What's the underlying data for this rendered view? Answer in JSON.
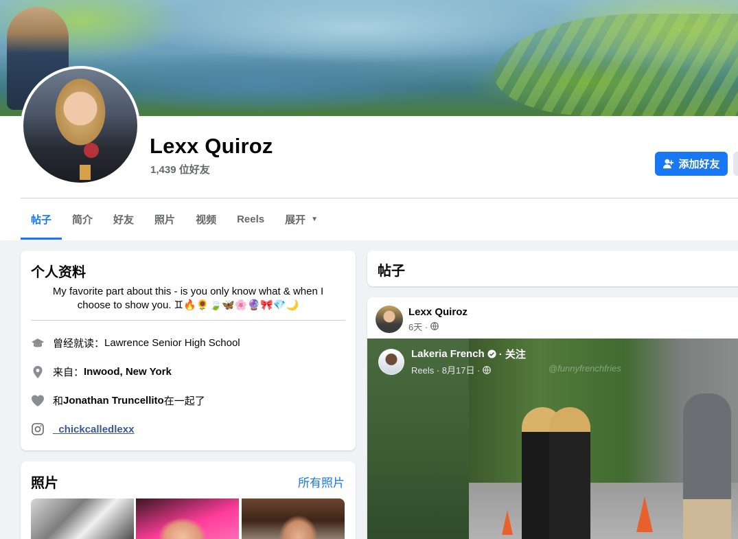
{
  "profile": {
    "name": "Lexx Quiroz",
    "friends_count": "1,439 位好友",
    "add_friend_label": "添加好友"
  },
  "tabs": [
    {
      "label": "帖子",
      "active": true
    },
    {
      "label": "简介"
    },
    {
      "label": "好友"
    },
    {
      "label": "照片"
    },
    {
      "label": "视频"
    },
    {
      "label": "Reels"
    },
    {
      "label": "展开"
    }
  ],
  "intro": {
    "title": "个人资料",
    "bio": "My favorite part about this - is you only know what & when I choose to show you. ♊🔥🌻🍃🦋🌸🔮🎀💎🌙",
    "education_prefix": "曾经就读：",
    "education_value": "Lawrence Senior High School",
    "from_prefix": "来自：",
    "from_value": "Inwood, New York",
    "relationship_prefix": "和 ",
    "relationship_name": "Jonathan Truncellito",
    "relationship_suffix": " 在一起了",
    "instagram": "_chickcalledlexx"
  },
  "photos": {
    "title": "照片",
    "all_link": "所有照片"
  },
  "posts": {
    "title": "帖子",
    "post": {
      "author": "Lexx Quiroz",
      "meta": "6天 ·",
      "shared": {
        "author": "Lakeria French",
        "follow": "· 关注",
        "meta": "Reels · 8月17日 ·",
        "watermark": "@funnyfrenchfries"
      }
    }
  },
  "colors": {
    "accent": "#1877f2",
    "secondary_text": "#65676b",
    "background": "#f0f2f5"
  }
}
